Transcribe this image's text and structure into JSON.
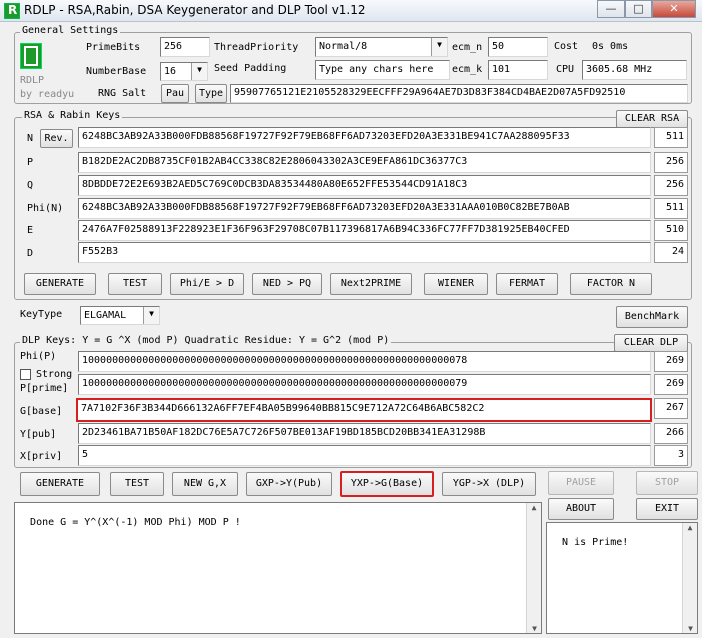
{
  "window": {
    "title": "RDLP - RSA,Rabin, DSA Keygenerator and DLP Tool v1.12",
    "minimize_glyph": "—",
    "maximize_glyph": "□",
    "close_glyph": "✕"
  },
  "general": {
    "title": "General Settings",
    "logo_text": "RDLP",
    "logo_sub": "by readyu",
    "primebits_label": "PrimeBits",
    "primebits_value": "256",
    "numberbase_label": "NumberBase",
    "numberbase_value": "16",
    "rngsalt_label": "RNG Salt",
    "pau_label": "Pau",
    "type_label": "Type",
    "thread_label": "ThreadPriority",
    "thread_value": "Normal/8",
    "seedpad_label": "Seed Padding",
    "seedpad_value": "Type any chars here",
    "ecm_n_label": "ecm_n",
    "ecm_n_value": "50",
    "ecm_k_label": "ecm_k",
    "ecm_k_value": "101",
    "cost_label": "Cost",
    "cost_value": "0s 0ms",
    "cpu_label": "CPU",
    "cpu_value": "3605.68 MHz",
    "salt_value": "95907765121E2105528329EECFFF29A964AE7D3D83F384CD4BAE2D07A5FD92510"
  },
  "rsa": {
    "title": "RSA  & Rabin Keys",
    "clear_label": "CLEAR RSA",
    "rev_label": "Rev.",
    "rows": [
      {
        "label": "N",
        "value": "6248BC3AB92A33B000FDB88568F19727F92F79EB68FF6AD73203EFD20A3E331BE941C7AA288095F33",
        "count": "511"
      },
      {
        "label": "P",
        "value": "B182DE2AC2DB8735CF01B2AB4CC338C82E2806043302A3CE9EFA861DC36377C3",
        "count": "256"
      },
      {
        "label": "Q",
        "value": "8DBDDE72E2E693B2AED5C769C0DCB3DA83534480A80E652FFE53544CD91A18C3",
        "count": "256"
      },
      {
        "label": "Phi(N)",
        "value": "6248BC3AB92A33B000FDB88568F19727F92F79EB68FF6AD73203EFD20A3E331AAA010B0C82BE7B0AB",
        "count": "511"
      },
      {
        "label": "E",
        "value": "2476A7F02588913F228923E1F36F963F29708C07B117396817A6B94C336FC77FF7D381925EB40CFED",
        "count": "510"
      },
      {
        "label": "D",
        "value": "F552B3",
        "count": "24"
      }
    ],
    "buttons": [
      "GENERATE",
      "TEST",
      "Phi/E > D",
      "NED > PQ",
      "Next2PRIME",
      "WIENER",
      "FERMAT",
      "FACTOR N"
    ]
  },
  "keytype": {
    "label": "KeyType",
    "value": "ELGAMAL",
    "benchmark_label": "BenchMark"
  },
  "dlp": {
    "title": "DLP Keys: Y = G ^X (mod P)  Quadratic Residue: Y = G^2 (mod P)",
    "clear_label": "CLEAR DLP",
    "strong_label": "Strong",
    "rows": [
      {
        "label": "Phi(P)",
        "value": "1000000000000000000000000000000000000000000000000000000000000078",
        "count": "269"
      },
      {
        "label": "P[prime]",
        "value": "1000000000000000000000000000000000000000000000000000000000000079",
        "count": "269"
      },
      {
        "label": "G[base]",
        "value": "7A7102F36F3B344D666132A6FF7EF4BA05B99640BB815C9E712A72C64B6ABC582C2",
        "count": "267"
      },
      {
        "label": "Y[pub]",
        "value": "2D23461BA71B50AF182DC76E5A7C726F507BE013AF19BD185BCD20BB341EA31298B",
        "count": "266"
      },
      {
        "label": "X[priv]",
        "value": "5",
        "count": "3"
      }
    ],
    "buttons": [
      "GENERATE",
      "TEST",
      "NEW G,X",
      "GXP->Y(Pub)",
      "YXP->G(Base)",
      "YGP->X (DLP)"
    ]
  },
  "controls": {
    "pause_label": "PAUSE",
    "stop_label": "STOP",
    "about_label": "ABOUT",
    "exit_label": "EXIT"
  },
  "log": {
    "main_text": "Done G = Y^(X^(-1) MOD Phi) MOD P !",
    "side_text": "N is Prime!"
  },
  "colors": {
    "highlight": "#d62020",
    "logo_green": "#1f9a2a"
  }
}
